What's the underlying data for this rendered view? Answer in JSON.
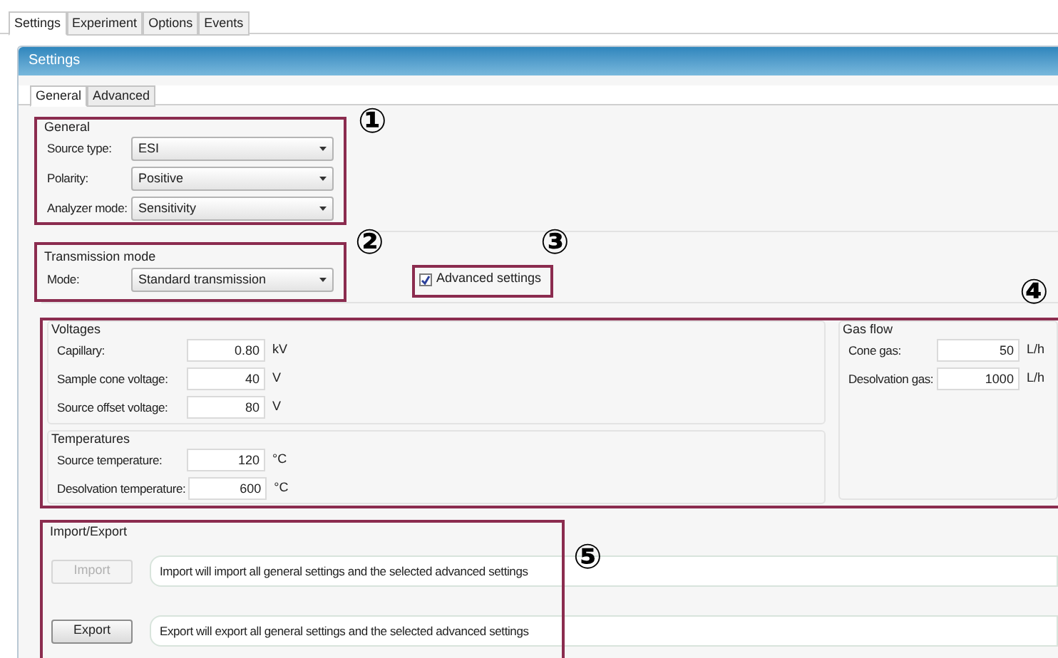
{
  "top_tabs": [
    {
      "label": "Settings",
      "selected": true
    },
    {
      "label": "Experiment",
      "selected": false
    },
    {
      "label": "Options",
      "selected": false
    },
    {
      "label": "Events",
      "selected": false
    }
  ],
  "panel": {
    "title": "Settings"
  },
  "sub_tabs": [
    {
      "label": "General",
      "selected": true
    },
    {
      "label": "Advanced",
      "selected": false
    }
  ],
  "general": {
    "heading": "General",
    "fields": [
      {
        "label": "Source type:",
        "value": "ESI"
      },
      {
        "label": "Polarity:",
        "value": "Positive"
      },
      {
        "label": "Analyzer mode:",
        "value": "Sensitivity"
      }
    ]
  },
  "transmission": {
    "heading": "Transmission mode",
    "fields": [
      {
        "label": "Mode:",
        "value": "Standard transmission"
      }
    ]
  },
  "advanced_settings": {
    "label": "Advanced settings",
    "checked": true
  },
  "voltages": {
    "heading": "Voltages",
    "fields": [
      {
        "label": "Capillary:",
        "value": "0.80",
        "unit": "kV"
      },
      {
        "label": "Sample cone voltage:",
        "value": "40",
        "unit": "V"
      },
      {
        "label": "Source offset voltage:",
        "value": "80",
        "unit": "V"
      }
    ]
  },
  "temperatures": {
    "heading": "Temperatures",
    "fields": [
      {
        "label": "Source temperature:",
        "value": "120",
        "unit": "°C"
      },
      {
        "label": "Desolvation temperature:",
        "value": "600",
        "unit": "°C"
      }
    ]
  },
  "gas_flow": {
    "heading": "Gas flow",
    "fields": [
      {
        "label": "Cone gas:",
        "value": "50",
        "unit": "L/h"
      },
      {
        "label": "Desolvation gas:",
        "value": "1000",
        "unit": "L/h"
      }
    ]
  },
  "import_export": {
    "heading": "Import/Export",
    "actions": [
      {
        "button": "Import",
        "disabled": true,
        "description": "Import will import all general settings and the selected advanced settings"
      },
      {
        "button": "Export",
        "disabled": false,
        "description": "Export will export all general settings and the selected advanced settings"
      }
    ]
  },
  "callouts": [
    "①",
    "②",
    "③",
    "④",
    "⑤"
  ]
}
